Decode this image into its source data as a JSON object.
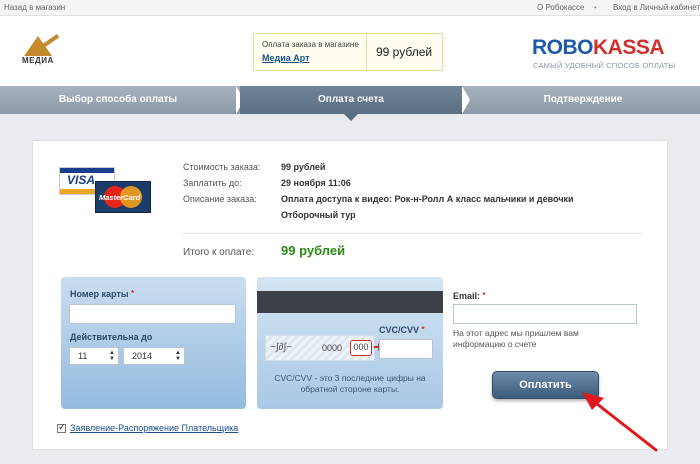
{
  "topbar": {
    "back_label": "Назад в магазин",
    "about_label": "О Робокассе",
    "separator": "•",
    "cabinet_label": "Вход в Личный кабинет"
  },
  "header": {
    "merchant_logo_text": "МЕДИА",
    "order_label": "Оплата заказа в магазине",
    "shop_name": "Медиа Арт",
    "price": "99 рублей",
    "brand_part1": "ROBO",
    "brand_part2": "KASSA",
    "brand_tagline": "САМЫЙ УДОБНЫЙ СПОСОБ ОПЛАТЫ"
  },
  "steps": [
    {
      "label": "Выбор способа оплаты"
    },
    {
      "label": "Оплата счета"
    },
    {
      "label": "Подтверждение"
    }
  ],
  "cards": {
    "visa": "VISA",
    "mastercard": "MasterCard"
  },
  "order": {
    "cost_key": "Стоимость заказа:",
    "cost_value": "99 рублей",
    "pay_until_key": "Заплатить до:",
    "pay_until_value": "29 ноября 11:06",
    "desc_key": "Описание заказа:",
    "desc_value_line1": "Оплата доступа к видео: Рок-н-Ролл А класс мальчики и девочки",
    "desc_value_line2": "Отборочный тур",
    "total_key": "Итого к оплате:",
    "total_value": "99 рублей"
  },
  "form": {
    "card_number_label": "Номер карты",
    "card_number_value": "",
    "valid_until_label": "Действительна до",
    "month_value": "11",
    "year_value": "2014",
    "required_mark": "*",
    "cvv_label": "CVC/CVV",
    "cvv_value": "",
    "card_sample_number": "0000",
    "card_sample_cvv": "000",
    "cvv_hint": "CVC/CVV - это 3 последние цифры на обратной стороне карты.",
    "email_label": "Email:",
    "email_value": "",
    "email_hint": "На этот адрес мы пришлем вам информацию о счете",
    "pay_button": "Оплатить",
    "agreement_link": "Заявление-Распоряжение Плательщика"
  },
  "colors": {
    "accent_blue": "#1e5aa8",
    "accent_red": "#d0312d",
    "total_green": "#2d8a14"
  }
}
